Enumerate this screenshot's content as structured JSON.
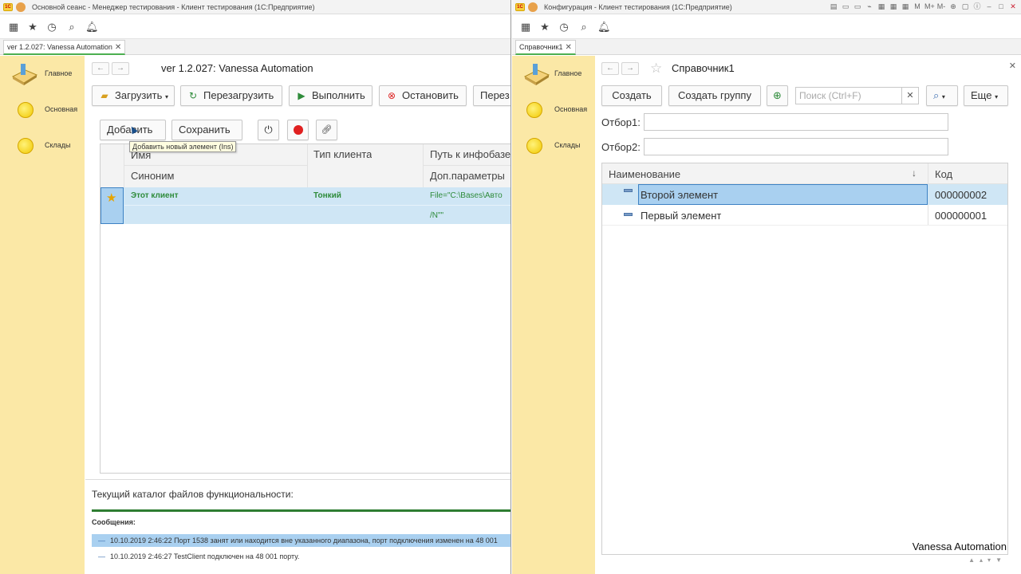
{
  "left_window": {
    "title": "Основной сеанс - Менеджер тестирования - Клиент тестирования (1С:Предприятие)",
    "logo_text": "1С",
    "tab_label": "ver 1.2.027: Vanessa Automation",
    "form_title": "ver 1.2.027: Vanessa Automation",
    "sidebar": [
      "Главное",
      "Основная",
      "Склады"
    ],
    "toolbar": {
      "load": "Загрузить",
      "reload": "Перезагрузить",
      "run": "Выполнить",
      "stop": "Остановить",
      "more": "Перез"
    },
    "grid_toolbar": {
      "add": "Добавить",
      "save": "Сохранить"
    },
    "tooltip": "Добавить новый элемент (Ins)",
    "columns": {
      "name": "Имя",
      "synonym": "Синоним",
      "client_type": "Тип клиента",
      "path": "Путь к инфобазе",
      "params": "Доп.параметры"
    },
    "row": {
      "name": "Этот клиент",
      "client_type": "Тонкий",
      "path": "File=\"C:\\Bases\\Авто",
      "params": "/N\"\""
    },
    "features_dir_label": "Текущий каталог файлов функциональности:",
    "messages_label": "Сообщения:",
    "messages": [
      "10.10.2019 2:46:22 Порт 1538 занят или находится вне указанного диапазона, порт подключения изменен на 48 001",
      "10.10.2019 2:46:27 TestClient подключен на 48 001 порту."
    ]
  },
  "right_window": {
    "title": "Конфигурация - Клиент тестирования (1С:Предприятие)",
    "logo_text": "1С",
    "tab_label": "Справочник1",
    "form_title": "Справочник1",
    "sidebar": [
      "Главное",
      "Основная",
      "Склады"
    ],
    "toolbar": {
      "create": "Создать",
      "create_group": "Создать группу",
      "search_placeholder": "Поиск (Ctrl+F)",
      "more": "Еще"
    },
    "filter1_label": "Отбор1:",
    "filter2_label": "Отбор2:",
    "columns": {
      "name": "Наименование",
      "code": "Код"
    },
    "rows": [
      {
        "name": "Второй элемент",
        "code": "000000002"
      },
      {
        "name": "Первый элемент",
        "code": "000000001"
      }
    ],
    "watermark": "Vanessa Automation"
  },
  "colors": {
    "sidebar_bg": "#fbe8a6",
    "selected_row": "#cfe6f5",
    "selected_cell": "#a9d0f0",
    "accent_green": "#2e7d32",
    "stop_red": "#e02020"
  },
  "icons": [
    "apps-grid-icon",
    "star-icon",
    "history-icon",
    "search-icon",
    "bell-icon",
    "back-arrow-icon",
    "forward-arrow-icon",
    "refresh-icon",
    "play-icon",
    "stop-icon",
    "power-icon",
    "record-icon",
    "link-icon",
    "favorite-star-icon",
    "add-copy-icon",
    "dropdown-icon",
    "close-icon"
  ]
}
